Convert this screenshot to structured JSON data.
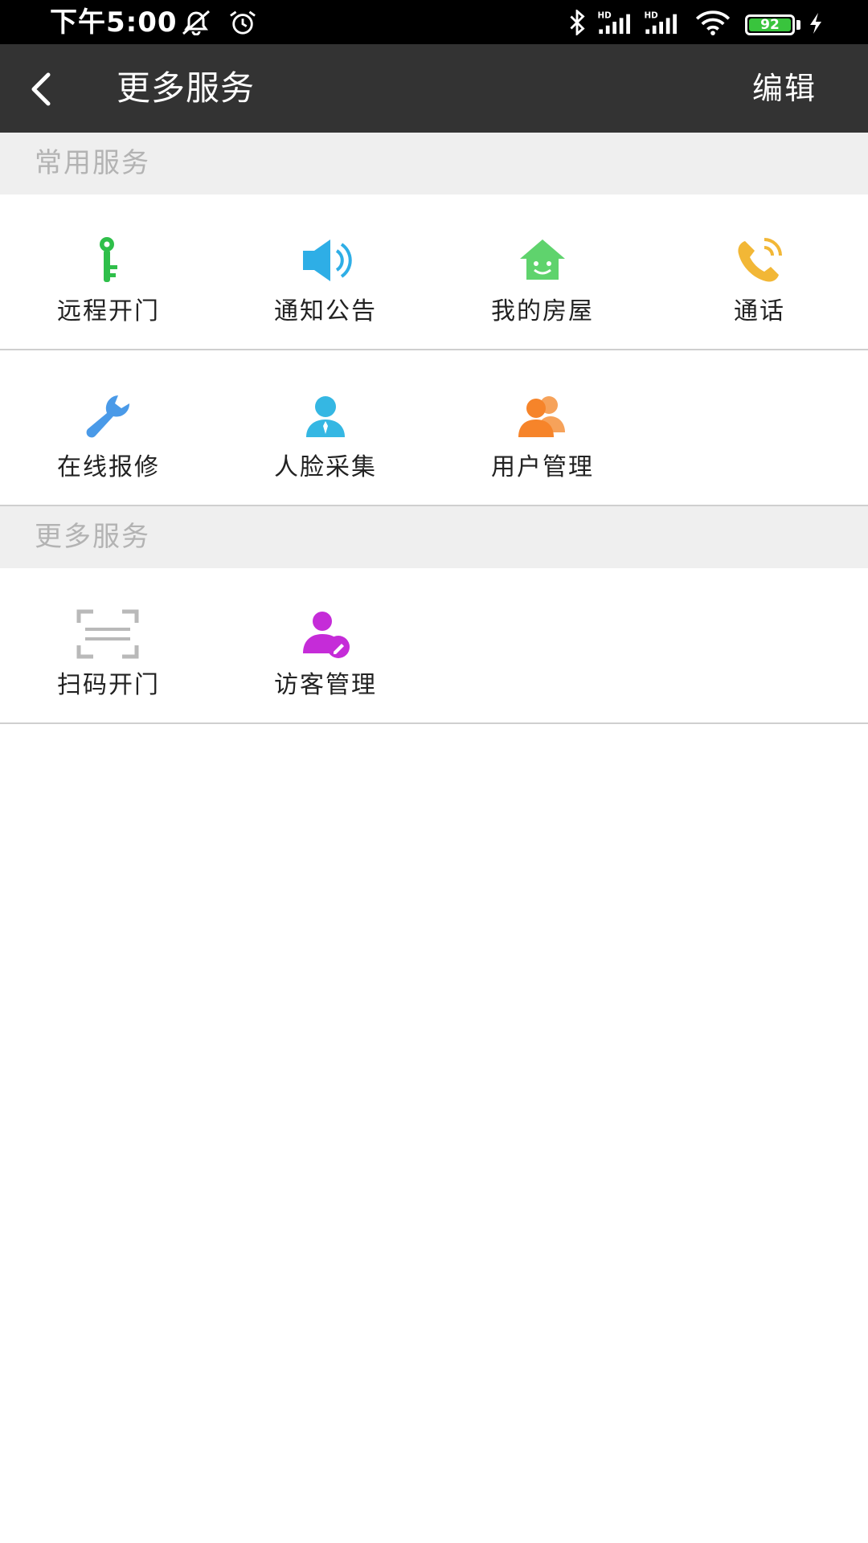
{
  "status_bar": {
    "time": "下午5:00",
    "battery": "92",
    "icons": [
      "mute-icon",
      "alarm-icon",
      "bluetooth-icon",
      "signal-hd-icon",
      "signal-hd-icon",
      "wifi-icon",
      "battery-icon",
      "charging-icon"
    ],
    "signal_label": "HD"
  },
  "header": {
    "title": "更多服务",
    "edit_label": "编辑"
  },
  "sections": [
    {
      "title": "常用服务",
      "items": [
        {
          "label": "远程开门",
          "icon": "key-icon",
          "color": "#2fbf4a"
        },
        {
          "label": "通知公告",
          "icon": "speaker-icon",
          "color": "#2eaee6"
        },
        {
          "label": "我的房屋",
          "icon": "house-icon",
          "color": "#5fd36d"
        },
        {
          "label": "通话",
          "icon": "phone-icon",
          "color": "#f2b736"
        },
        {
          "label": "在线报修",
          "icon": "wrench-icon",
          "color": "#4a9ae8"
        },
        {
          "label": "人脸采集",
          "icon": "person-icon",
          "color": "#35b7e3"
        },
        {
          "label": "用户管理",
          "icon": "users-icon",
          "color": "#f6842a"
        }
      ]
    },
    {
      "title": "更多服务",
      "items": [
        {
          "label": "扫码开门",
          "icon": "scan-icon",
          "color": "#b9b9b9"
        },
        {
          "label": "访客管理",
          "icon": "visitor-icon",
          "color": "#c52cd8"
        }
      ]
    }
  ]
}
